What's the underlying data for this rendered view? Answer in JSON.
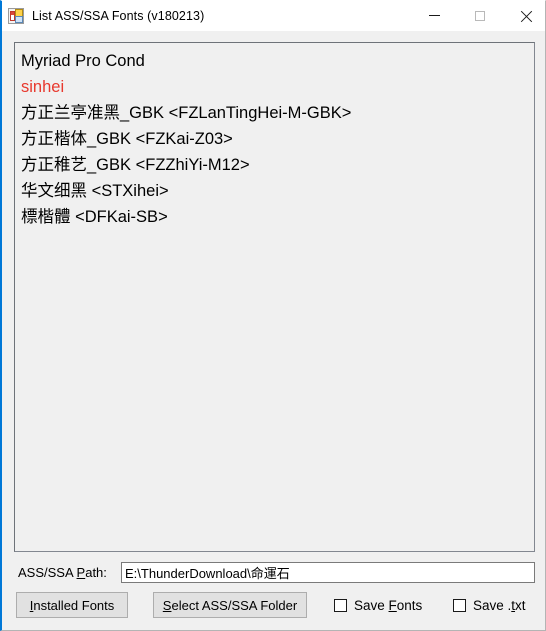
{
  "window": {
    "title": "List ASS/SSA Fonts (v180213)",
    "icon": "form-window-icon",
    "accent_border": "#0078d7",
    "background": "#f0f0f0"
  },
  "titlebar_controls": {
    "minimize": "minimize-icon",
    "maximize": "maximize-icon",
    "close": "close-icon"
  },
  "font_list": {
    "text_color": "#000000",
    "highlight_color": "#e8392e",
    "items": [
      {
        "text": "Myriad Pro Cond",
        "color": "#000000"
      },
      {
        "text": "sinhei",
        "color": "#e8392e"
      },
      {
        "text": "方正兰亭准黑_GBK <FZLanTingHei-M-GBK>",
        "color": "#000000"
      },
      {
        "text": "方正楷体_GBK <FZKai-Z03>",
        "color": "#000000"
      },
      {
        "text": "方正稚艺_GBK <FZZhiYi-M12>",
        "color": "#000000"
      },
      {
        "text": "华文细黑 <STXihei>",
        "color": "#000000"
      },
      {
        "text": "標楷體 <DFKai-SB>",
        "color": "#000000"
      }
    ]
  },
  "path_row": {
    "label_before": "ASS/SSA ",
    "label_accel": "P",
    "label_after": "ath:",
    "value": "E:\\ThunderDownload\\命運石",
    "placeholder": ""
  },
  "buttons": {
    "installed_fonts": {
      "accel": "I",
      "after": "nstalled Fonts"
    },
    "select_folder": {
      "accel": "S",
      "after": "elect ASS/SSA Folder"
    }
  },
  "checkboxes": [
    {
      "before": "Save ",
      "accel": "F",
      "after": "onts",
      "checked": false,
      "name": "save-fonts"
    },
    {
      "before": "Save .",
      "accel": "t",
      "after": "xt",
      "checked": false,
      "name": "save-txt"
    }
  ]
}
